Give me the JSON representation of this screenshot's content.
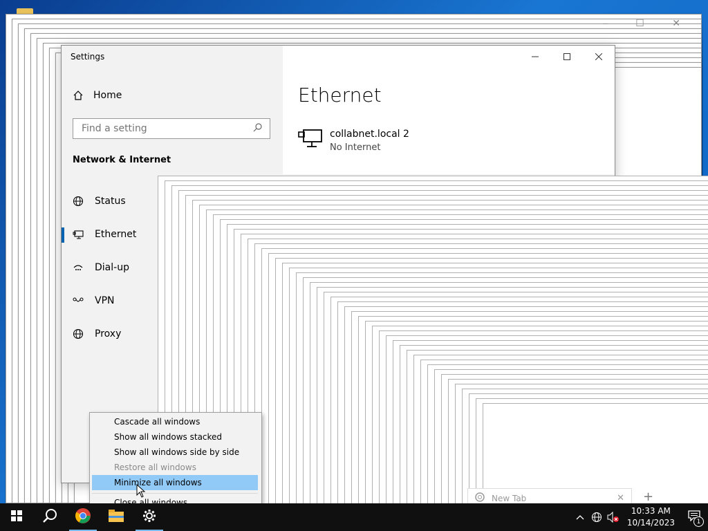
{
  "settings": {
    "app_title": "Settings",
    "home_label": "Home",
    "search_placeholder": "Find a setting",
    "section_title": "Network & Internet",
    "nav": [
      {
        "label": "Status",
        "icon": "globe-status-icon"
      },
      {
        "label": "Ethernet",
        "icon": "ethernet-icon",
        "active": true
      },
      {
        "label": "Dial-up",
        "icon": "dial-up-icon"
      },
      {
        "label": "VPN",
        "icon": "vpn-icon"
      },
      {
        "label": "Proxy",
        "icon": "globe-icon"
      }
    ],
    "page_heading": "Ethernet",
    "connection": {
      "name": "collabnet.local 2",
      "status": "No Internet"
    }
  },
  "context_menu": {
    "items": [
      {
        "label": "Cascade all windows",
        "state": "normal"
      },
      {
        "label": "Show all windows stacked",
        "state": "normal"
      },
      {
        "label": "Show all windows side by side",
        "state": "normal"
      },
      {
        "label": "Restore all windows",
        "state": "disabled"
      },
      {
        "label": "Minimize all windows",
        "state": "highlighted"
      },
      {
        "label": "Close all windows",
        "state": "normal"
      }
    ]
  },
  "browser": {
    "tab_label": "New Tab"
  },
  "taskbar": {
    "apps": [
      "start-icon",
      "search-icon",
      "chrome-icon",
      "file-explorer-icon",
      "settings-gear-icon"
    ],
    "clock": {
      "time": "10:33 AM",
      "date": "10/14/2023"
    },
    "notification_count": "1"
  },
  "colors": {
    "accent": "#0063b1",
    "menu_highlight": "#91c9f7",
    "taskbar": "#101010"
  }
}
